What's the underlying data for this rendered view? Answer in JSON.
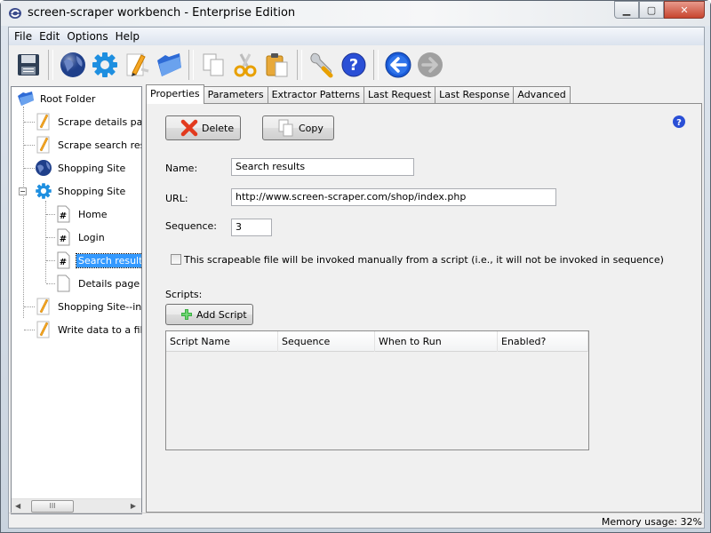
{
  "window": {
    "title": "screen-scraper workbench - Enterprise Edition",
    "controls": {
      "minimize": "minimize",
      "maximize": "maximize",
      "close": "close"
    }
  },
  "menu": [
    "File",
    "Edit",
    "Options",
    "Help"
  ],
  "toolbar": {
    "buttons": [
      {
        "name": "save",
        "icon": "floppy-disk-icon"
      },
      {
        "name": "new-site",
        "icon": "globe-icon"
      },
      {
        "name": "new-scraping-session",
        "icon": "gear-icon"
      },
      {
        "name": "new-script",
        "icon": "pencil-document-icon"
      },
      {
        "name": "open-folder",
        "icon": "folder-icon"
      },
      {
        "name": "copy",
        "icon": "copy-icon"
      },
      {
        "name": "cut",
        "icon": "scissors-icon"
      },
      {
        "name": "paste",
        "icon": "clipboard-icon"
      },
      {
        "name": "settings",
        "icon": "wrench-icon"
      },
      {
        "name": "help",
        "icon": "help-icon"
      },
      {
        "name": "back",
        "icon": "arrow-left-icon"
      },
      {
        "name": "forward",
        "icon": "arrow-right-icon",
        "disabled": true
      }
    ]
  },
  "tree": {
    "items": [
      {
        "label": "Root Folder",
        "icon": "folder-icon",
        "level": 0
      },
      {
        "label": "Scrape details page",
        "icon": "script-icon",
        "level": 1
      },
      {
        "label": "Scrape search resul",
        "icon": "script-icon",
        "level": 1
      },
      {
        "label": "Shopping Site",
        "icon": "globe-icon",
        "level": 1
      },
      {
        "label": "Shopping Site",
        "icon": "gear-icon",
        "level": 1,
        "expanded": true
      },
      {
        "label": "Home",
        "icon": "scrapeable-file-icon",
        "level": 2
      },
      {
        "label": "Login",
        "icon": "scrapeable-file-icon",
        "level": 2
      },
      {
        "label": "Search results",
        "icon": "scrapeable-file-icon",
        "level": 2,
        "selected": true
      },
      {
        "label": "Details page",
        "icon": "page-icon",
        "level": 2
      },
      {
        "label": "Shopping Site--initia",
        "icon": "script-icon",
        "level": 1
      },
      {
        "label": "Write data to a file",
        "icon": "script-icon",
        "level": 1
      }
    ],
    "scroll_thumb_glyph": "III"
  },
  "tabs": [
    {
      "label": "Properties",
      "active": true
    },
    {
      "label": "Parameters"
    },
    {
      "label": "Extractor Patterns"
    },
    {
      "label": "Last Request"
    },
    {
      "label": "Last Response"
    },
    {
      "label": "Advanced"
    }
  ],
  "properties": {
    "delete_label": "Delete",
    "copy_label": "Copy",
    "name_label": "Name:",
    "name_value": "Search results",
    "url_label": "URL:",
    "url_value": "http://www.screen-scraper.com/shop/index.php",
    "sequence_label": "Sequence:",
    "sequence_value": "3",
    "manual_checkbox_label": "This scrapeable file will be invoked manually from a script (i.e., it will not be invoked in sequence)",
    "manual_checked": false,
    "scripts_label": "Scripts:",
    "add_script_label": "Add Script",
    "scripts_table": {
      "columns": [
        "Script Name",
        "Sequence",
        "When to Run",
        "Enabled?"
      ],
      "rows": []
    }
  },
  "status": {
    "memory": "Memory usage: 32%"
  },
  "colors": {
    "selection": "#3399ff",
    "help_blue": "#2a4fd6",
    "close_red": "#c7452f"
  }
}
